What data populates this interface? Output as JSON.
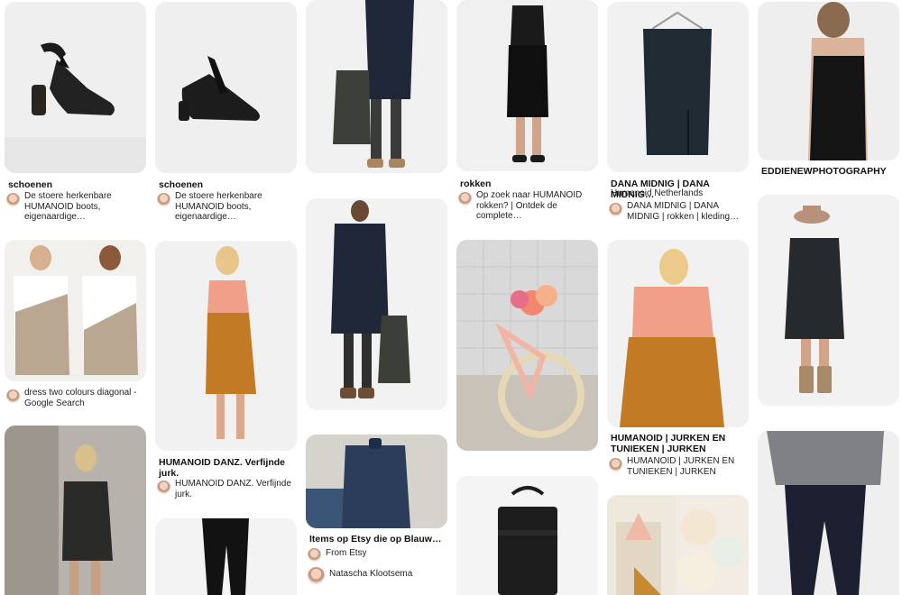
{
  "pins": [
    {
      "title": "schoenen",
      "desc": "De stoere herkenbare HUMANOID boots, eigenaardige…"
    },
    {
      "title": "",
      "desc": "dress two colours diagonal - Google Search"
    },
    {
      "title": "schoenen",
      "desc": "De stoere herkenbare HUMANOID boots, eigenaardige…"
    },
    {
      "title": "HUMANOID DANZ. Verfijnde jurk.",
      "desc": "HUMANOID DANZ. Verfijnde jurk."
    },
    {
      "title": "Items op Etsy die op Blauw…",
      "source": "From Etsy",
      "author": "Natascha Klootsema"
    },
    {
      "title": "rokken",
      "desc": "Op zoek naar HUMANOID rokken? | Ontdek de complete…"
    },
    {
      "title": "DANA MIDNIG | DANA MIDNIG…",
      "subtitle": "Humanoid Netherlands",
      "desc": "DANA MIDNIG | DANA MIDNIG | rokken | kleding…"
    },
    {
      "title": "HUMANOID | JURKEN EN TUNIEKEN | JURKEN",
      "desc": "HUMANOID | JURKEN EN TUNIEKEN | JURKEN"
    },
    {
      "title": "EDDIENEWPHOTOGRAPHY"
    }
  ],
  "colors": {
    "background": "#ffffff",
    "navy": "#1f2738",
    "black": "#151515",
    "coral": "#f0a088",
    "mustard": "#c27a25",
    "grey_wall": "#dcdcdc"
  }
}
